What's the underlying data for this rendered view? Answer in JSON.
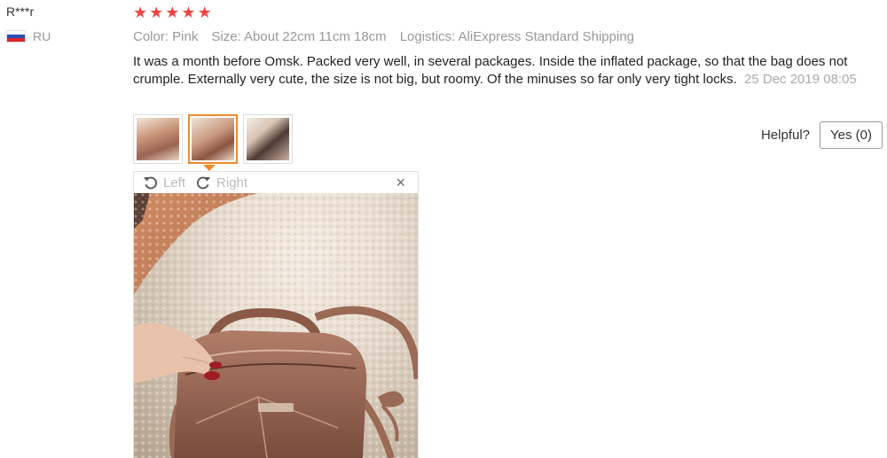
{
  "user": {
    "name": "R***r",
    "country": "RU"
  },
  "rating": {
    "stars": 5
  },
  "meta": {
    "color": "Color: Pink",
    "size": "Size: About 22cm 11cm 18cm",
    "logistics": "Logistics: AliExpress Standard Shipping"
  },
  "review": {
    "text": "It was a month before Omsk. Packed very well, in several packages. Inside the inflated package, so that the bag does not crumple. Externally very cute, the size is not big, but roomy. Of the minuses so far only very tight locks.",
    "date": "25 Dec 2019 08:05"
  },
  "thumbnails": {
    "count": 3,
    "active_index": 1
  },
  "helpful": {
    "label": "Helpful?",
    "yes_button": "Yes (0)"
  },
  "viewer": {
    "rotate_left": "Left",
    "rotate_right": "Right",
    "close": "×"
  },
  "colors": {
    "star": "#f04848",
    "active_thumb": "#f08a2c",
    "muted_text": "#999999"
  }
}
